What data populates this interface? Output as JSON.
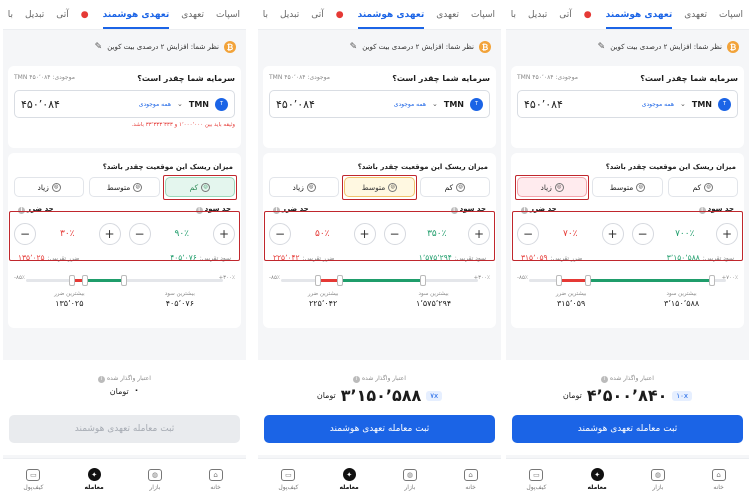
{
  "tabs": [
    "اسپات",
    "تعهدی",
    "تعهدی هوشمند",
    "آتی",
    "تبدیل",
    "با"
  ],
  "active_tab_index": 2,
  "view_text": "نظر شما: افزایش ۲ درصدی بیت کوین",
  "amount_question": "سرمایه شما چقدر است؟",
  "balance_label": "موجودی: ۴۵۰٬۰۸۴ TMN",
  "currency": "TMN",
  "all_balance": "همه موجودی",
  "risk_question": "میزان ریسک این موقعیت چقدر باشد؟",
  "risk_options": [
    "کم",
    "متوسط",
    "زیاد"
  ],
  "profit_label": "حد سود",
  "loss_label": "حد ضرر",
  "approx_profit_label": "سود تقریبی:",
  "approx_loss_label": "ضرر تقریبی:",
  "max_profit_label": "بیشترین سود",
  "max_loss_label": "بیشترین ضرر",
  "credit_label": "اعتبار واگذار شده",
  "unit": "تومان",
  "submit_label": "ثبت معامله تعهدی هوشمند",
  "nav": [
    "خانه",
    "بازار",
    "معامله",
    "کیف‌پول"
  ],
  "nav_active_index": 2,
  "colors": {
    "accent": "#1b64e6",
    "profit": "#1f9d6b",
    "loss": "#e53935",
    "highlight": "#c0272d"
  },
  "screens": [
    {
      "amount": "۴۵۰٬۰۸۴",
      "warning": "وثیقه باید بین ۱٬۰۰۰٬۰۰۰ و ۳۳٬۳۳۳٬۳۳۳ باشد.",
      "risk_selected": 0,
      "profit_pct": "۹۰٪",
      "loss_pct": "۳۰٪",
      "approx_profit": "۴۰۵٬۰۷۶",
      "approx_loss": "۱۳۵٬۰۲۵",
      "bar_left": "-۸۵٪",
      "bar_right": "+۳۰۰٪",
      "loss_fraction": 0.22,
      "profit_fraction": 0.28,
      "max_profit": "۴۰۵٬۰۷۶",
      "max_loss": "۱۳۵٬۰۲۵",
      "total": "۰",
      "leverage": "",
      "submit_enabled": false
    },
    {
      "amount": "۴۵۰٬۰۸۴",
      "warning": "",
      "risk_selected": 1,
      "profit_pct": "۳۵۰٪",
      "loss_pct": "۵۰٪",
      "approx_profit": "۱٬۵۷۵٬۲۹۴",
      "approx_loss": "۲۲۵٬۰۴۲",
      "bar_left": "-۸۵٪",
      "bar_right": "+۳۰۰٪",
      "loss_fraction": 0.37,
      "profit_fraction": 0.6,
      "max_profit": "۱٬۵۷۵٬۲۹۴",
      "max_loss": "۲۲۵٬۰۴۲",
      "total": "۳٬۱۵۰٬۵۸۸",
      "leverage": "۷x",
      "submit_enabled": true
    },
    {
      "amount": "۴۵۰٬۰۸۴",
      "warning": "",
      "risk_selected": 2,
      "profit_pct": "۷۰۰٪",
      "loss_pct": "۷۰٪",
      "approx_profit": "۳٬۱۵۰٬۵۸۸",
      "approx_loss": "۳۱۵٬۰۵۹",
      "bar_left": "-۸۵٪",
      "bar_right": "+۷۰۰٪",
      "loss_fraction": 0.5,
      "profit_fraction": 0.9,
      "max_profit": "۳٬۱۵۰٬۵۸۸",
      "max_loss": "۳۱۵٬۰۵۹",
      "total": "۴٬۵۰۰٬۸۴۰",
      "leverage": "۱۰x",
      "submit_enabled": true
    }
  ]
}
